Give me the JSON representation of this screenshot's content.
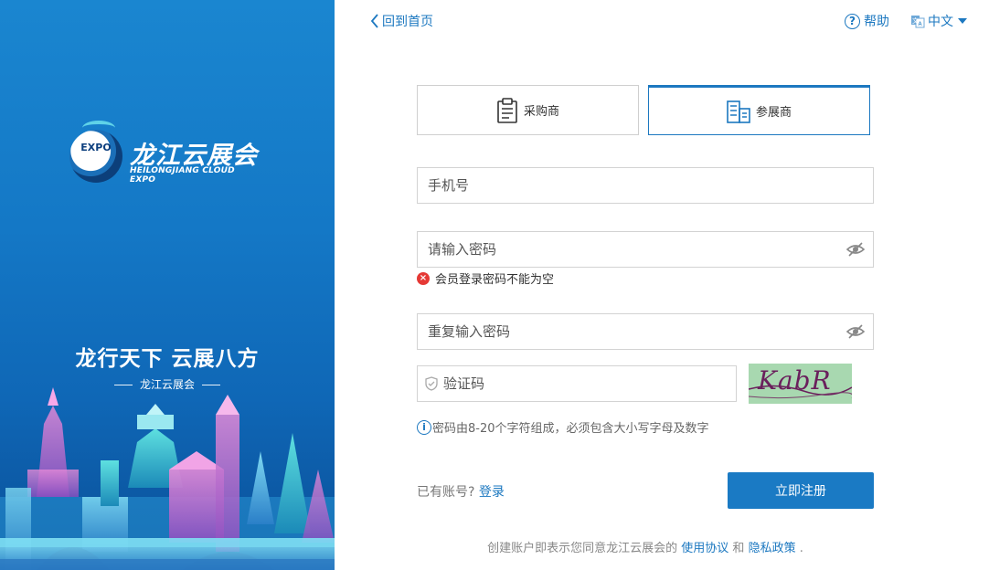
{
  "nav": {
    "back_label": "回到首页",
    "help_label": "帮助",
    "lang_label": "中文"
  },
  "brand": {
    "badge_text": "EXPO",
    "name_cn": "龙江云展会",
    "name_en": "HEILONGJIANG CLOUD EXPO",
    "slogan": "龙行天下 云展八方",
    "slogan_sub": "龙江云展会"
  },
  "tabs": [
    {
      "label": "采购商",
      "icon": "clipboard-icon",
      "active": false
    },
    {
      "label": "参展商",
      "icon": "building-icon",
      "active": true
    }
  ],
  "form": {
    "phone_placeholder": "手机号",
    "password_placeholder": "请输入密码",
    "password_error": "会员登录密码不能为空",
    "repeat_placeholder": "重复输入密码",
    "captcha_placeholder": "验证码",
    "captcha_image_text": "KabR",
    "password_hint": "密码由8-20个字符组成，必须包含大小写字母及数字"
  },
  "footer": {
    "has_account": "已有账号?",
    "login_link": "登录",
    "register_button": "立即注册",
    "agreement_prefix": "创建账户即表示您同意龙江云展会的",
    "terms_link": "使用协议",
    "and": "和",
    "privacy_link": "隐私政策",
    "agreement_suffix": "."
  },
  "colors": {
    "accent": "#1c78c0",
    "error": "#e53935",
    "panel": "#1478c6"
  }
}
